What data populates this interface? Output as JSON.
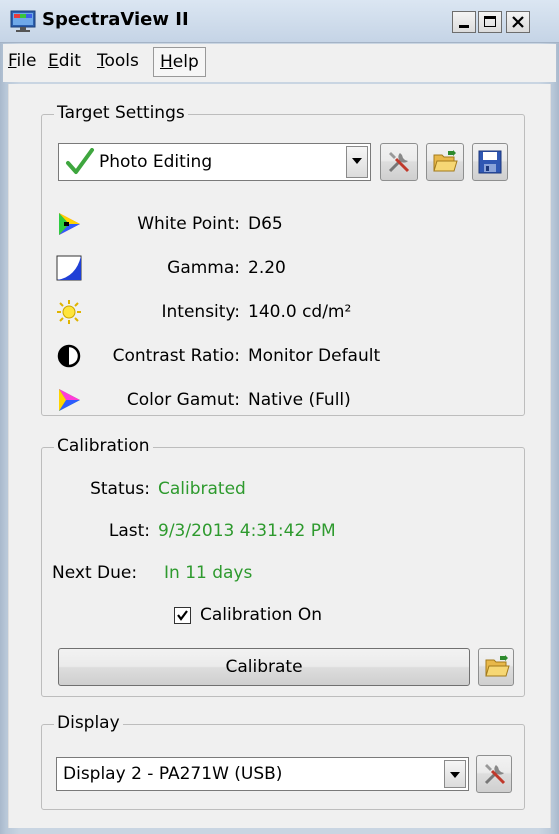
{
  "window": {
    "title": "SpectraView II"
  },
  "menu": [
    {
      "label": "File",
      "accel": "F",
      "rest": "ile"
    },
    {
      "label": "Edit",
      "accel": "E",
      "rest": "dit"
    },
    {
      "label": "Tools",
      "accel": "T",
      "rest": "ools"
    },
    {
      "label": "Help",
      "accel": "H",
      "rest": "elp"
    }
  ],
  "target_settings": {
    "group_label": "Target Settings",
    "preset": "Photo Editing",
    "buttons": [
      "tools-icon",
      "open-folder-icon",
      "save-icon"
    ],
    "rows": [
      {
        "label": "White Point:",
        "value": "D65",
        "icon": "white-point-icon"
      },
      {
        "label": "Gamma:",
        "value": "2.20",
        "icon": "gamma-icon"
      },
      {
        "label": "Intensity:",
        "value": "140.0 cd/m²",
        "icon": "intensity-sun-icon"
      },
      {
        "label": "Contrast Ratio:",
        "value": "Monitor Default",
        "icon": "contrast-icon"
      },
      {
        "label": "Color Gamut:",
        "value": "Native (Full)",
        "icon": "color-gamut-icon"
      }
    ]
  },
  "calibration": {
    "group_label": "Calibration",
    "status_label": "Status:",
    "status_value": "Calibrated",
    "last_label": "Last:",
    "last_value": "9/3/2013 4:31:42 PM",
    "next_label": "Next Due:",
    "next_value": "In 11 days",
    "toggle_label": "Calibration On",
    "toggle_checked": true,
    "calibrate_label": "Calibrate",
    "status_color": "#2e9a2e"
  },
  "display": {
    "group_label": "Display",
    "selected": "Display 2 - PA271W (USB)"
  }
}
